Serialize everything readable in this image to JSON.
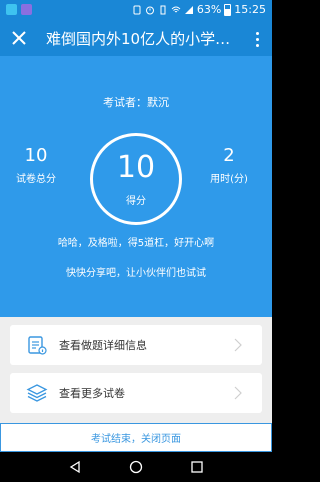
{
  "status_bar": {
    "battery": "63%",
    "time": "15:25",
    "icons": [
      "app-icon-1",
      "app-icon-2",
      "sim-icon",
      "alarm-icon",
      "vibrate-icon",
      "wifi-icon",
      "signal-icon",
      "battery-icon"
    ]
  },
  "header": {
    "title": "难倒国内外10亿人的小学智…",
    "close_icon": "close-icon",
    "more_icon": "more-vertical-icon"
  },
  "result": {
    "examinee": "考试者：默沉",
    "total_value": "10",
    "total_label": "试卷总分",
    "score_value": "10",
    "score_label": "得分",
    "time_value": "2",
    "time_label": "用时(分)",
    "message1": "哈哈，及格啦，得5道杠，好开心啊",
    "message2": "快快分享吧，让小伙伴们也试试"
  },
  "actions": [
    {
      "label": "查看做题详细信息",
      "icon": "document-info-icon"
    },
    {
      "label": "查看更多试卷",
      "icon": "layers-icon"
    }
  ],
  "footer": {
    "label": "考试结束，关闭页面"
  },
  "colors": {
    "primary": "#2f9aea",
    "header": "#1a87d6",
    "link": "#3a97e0",
    "background": "#eeeeee"
  }
}
